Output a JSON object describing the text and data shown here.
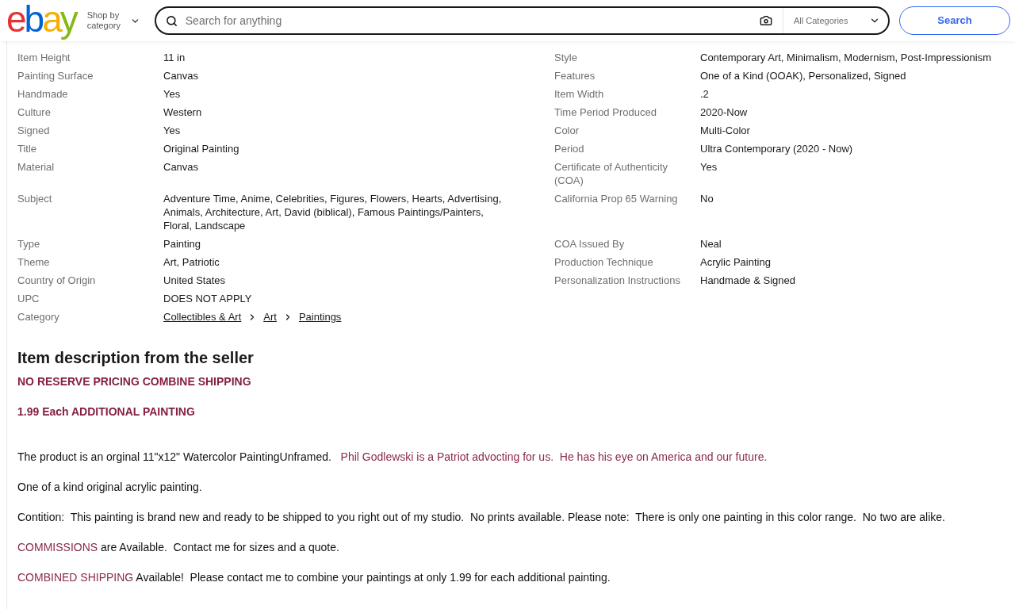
{
  "header": {
    "logo": [
      {
        "text": "e",
        "color": "#e53238"
      },
      {
        "text": "b",
        "color": "#0064d2"
      },
      {
        "text": "a",
        "color": "#f5af02"
      },
      {
        "text": "y",
        "color": "#86b817"
      }
    ],
    "shop_by_category": "Shop by category",
    "search": {
      "placeholder": "Search for anything",
      "category": "All Categories"
    },
    "search_button": "Search"
  },
  "item_specifics": {
    "left": [
      {
        "label": "Item Height",
        "value": "11 in"
      },
      {
        "label": "Painting Surface",
        "value": "Canvas"
      },
      {
        "label": "Handmade",
        "value": "Yes"
      },
      {
        "label": "Culture",
        "value": "Western"
      },
      {
        "label": "Signed",
        "value": "Yes"
      },
      {
        "label": "Title",
        "value": "Original Painting"
      },
      {
        "label": "Material",
        "value": "Canvas"
      },
      {
        "label": "Subject",
        "value": "Adventure Time, Anime, Celebrities, Figures, Flowers, Hearts, Advertising, Animals, Architecture, Art, David (biblical), Famous Paintings/Painters, Floral, Landscape"
      },
      {
        "label": "Type",
        "value": "Painting"
      },
      {
        "label": "Theme",
        "value": "Art, Patriotic"
      },
      {
        "label": "Country of Origin",
        "value": "United States"
      },
      {
        "label": "UPC",
        "value": "DOES NOT APPLY"
      }
    ],
    "category": {
      "label": "Category",
      "links": [
        "Collectibles & Art",
        "Art",
        "Paintings"
      ]
    },
    "right": [
      {
        "label": "Style",
        "value": "Contemporary Art, Minimalism, Modernism, Post-Impressionism"
      },
      {
        "label": "Features",
        "value": "One of a Kind (OOAK), Personalized, Signed"
      },
      {
        "label": "Item Width",
        "value": ".2"
      },
      {
        "label": "Time Period Produced",
        "value": "2020-Now"
      },
      {
        "label": "Color",
        "value": "Multi-Color"
      },
      {
        "label": "Period",
        "value": "Ultra Contemporary (2020 - Now)"
      },
      {
        "label": "Certificate of Authenticity (COA)",
        "value": "Yes"
      },
      {
        "label": "California Prop 65 Warning",
        "value": "No"
      },
      {
        "label": "COA Issued By",
        "value": "Neal"
      },
      {
        "label": "Production Technique",
        "value": "Acrylic Painting"
      },
      {
        "label": "Personalization Instructions",
        "value": "Handmade & Signed"
      }
    ]
  },
  "description": {
    "title": "Item description from the seller",
    "notices": [
      "NO RESERVE PRICING COMBINE SHIPPING",
      "1.99 Each ADDITIONAL PAINTING"
    ],
    "paragraphs": [
      {
        "segments": [
          {
            "text": "The product is an orginal 11\"x12\" Watercolor PaintingUnframed.   ",
            "highlighted": false
          },
          {
            "text": "Phil Godlewski is a Patriot advocting for us.  He has his eye on America and our future.",
            "highlighted": true
          }
        ]
      },
      {
        "segments": [
          {
            "text": "One of a kind original acrylic painting.",
            "highlighted": false
          }
        ]
      },
      {
        "segments": [
          {
            "text": "Contition:  This painting is brand new and ready to be shipped to you right out of my studio.  No prints available. Please note:  There is only one painting in this color range.  No two are alike.",
            "highlighted": false
          }
        ]
      },
      {
        "segments": [
          {
            "text": "COMMISSIONS",
            "highlighted": true
          },
          {
            "text": " are Available.  Contact me for sizes and a quote.",
            "highlighted": false
          }
        ]
      },
      {
        "segments": [
          {
            "text": "COMBINED SHIPPING",
            "highlighted": true
          },
          {
            "text": " Available!  Please contact me to combine your paintings at only 1.99 for each additional painting.",
            "highlighted": false
          }
        ]
      }
    ]
  }
}
